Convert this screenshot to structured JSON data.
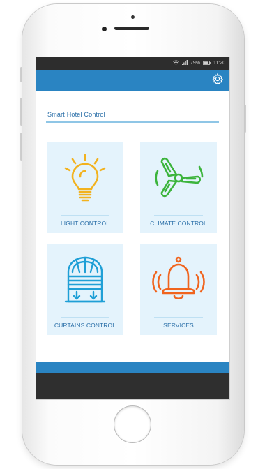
{
  "status_bar": {
    "battery_percent": "79%",
    "time": "11:20"
  },
  "app": {
    "title": "Smart Hotel Control"
  },
  "icons": {
    "settings": "gear-icon",
    "light": "light-bulb-icon",
    "climate": "fan-icon",
    "curtains": "curtains-window-icon",
    "services": "bell-icon"
  },
  "tiles": [
    {
      "label": "LIGHT CONTROL",
      "icon_color": "#f2b21f"
    },
    {
      "label": "CLIMATE CONTROL",
      "icon_color": "#3cb43c"
    },
    {
      "label": "CURTAINS CONTROL",
      "icon_color": "#1f9fd6"
    },
    {
      "label": "SERVICES",
      "icon_color": "#f0641e"
    }
  ],
  "colors": {
    "accent": "#2a84c2",
    "tile_background": "#e4f3fc",
    "label_text": "#2a6fa8"
  }
}
